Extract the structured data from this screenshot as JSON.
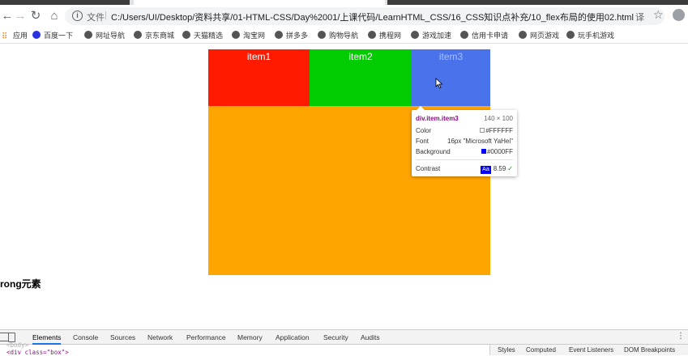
{
  "browser": {
    "address_prefix": "文件",
    "url": "C:/Users/UI/Desktop/资料共享/01-HTML-CSS/Day%2001/上课代码/LearnHTML_CSS/16_CSS知识点补充/10_flex布局的使用02.html",
    "icons": [
      "back-icon",
      "forward-icon",
      "reload-icon",
      "home-icon",
      "info-icon",
      "translate-icon",
      "star-icon",
      "account-icon"
    ]
  },
  "bookmarks": [
    {
      "label": "应用",
      "icon": "apps-icon"
    },
    {
      "label": "百度一下",
      "icon": "baidu-icon"
    },
    {
      "label": "网址导航",
      "icon": "globe-icon"
    },
    {
      "label": "京东商城",
      "icon": "globe-icon"
    },
    {
      "label": "天猫精选",
      "icon": "globe-icon"
    },
    {
      "label": "淘宝网",
      "icon": "globe-icon"
    },
    {
      "label": "拼多多",
      "icon": "globe-icon"
    },
    {
      "label": "购物导航",
      "icon": "globe-icon"
    },
    {
      "label": "携程网",
      "icon": "globe-icon"
    },
    {
      "label": "游戏加速",
      "icon": "globe-icon"
    },
    {
      "label": "信用卡申请",
      "icon": "globe-icon"
    },
    {
      "label": "网页游戏",
      "icon": "globe-icon"
    },
    {
      "label": "玩手机游戏",
      "icon": "globe-icon"
    }
  ],
  "page": {
    "items": [
      "item1",
      "item2",
      "item3"
    ],
    "strong_text": "rong元素",
    "colors": {
      "item1": "#ff1a00",
      "item2": "#00cc00",
      "item3": "#4a72ea",
      "container": "#ffa500"
    }
  },
  "tooltip": {
    "selector": "div.item.item3",
    "dimensions": "140 × 100",
    "color_label": "Color",
    "color_value": "#FFFFFF",
    "font_label": "Font",
    "font_value": "16px \"Microsoft YaHei\"",
    "background_label": "Background",
    "background_value": "#0000FF",
    "contrast_label": "Contrast",
    "contrast_badge": "Aa",
    "contrast_value": "8.59"
  },
  "devtools": {
    "tabs": [
      "Elements",
      "Console",
      "Sources",
      "Network",
      "Performance",
      "Memory",
      "Application",
      "Security",
      "Audits"
    ],
    "active_tab": "Elements",
    "dom_lines": [
      "<body>",
      "<div class=\"box\">"
    ],
    "style_tabs": [
      "Styles",
      "Computed",
      "Event Listeners",
      "DOM Breakpoints"
    ]
  }
}
